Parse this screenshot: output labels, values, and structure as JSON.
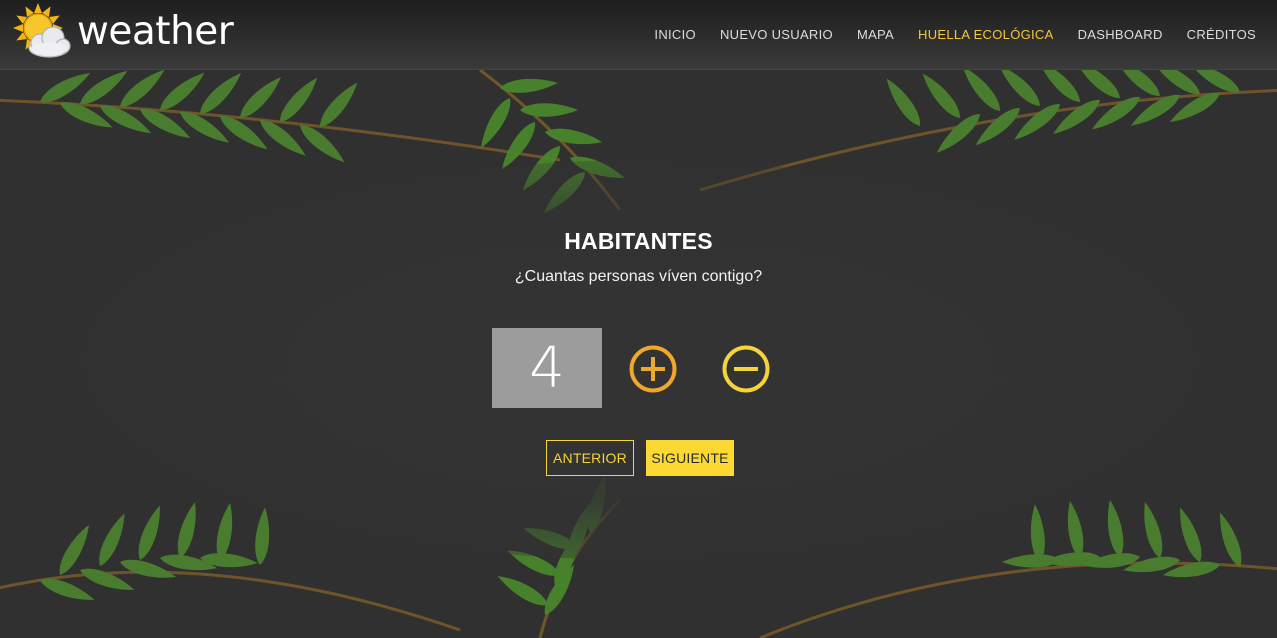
{
  "brand": {
    "name": "weather",
    "logo_icon": "sun-cloud-icon"
  },
  "nav": {
    "items": [
      {
        "label": "INICIO",
        "active": false
      },
      {
        "label": "NUEVO USUARIO",
        "active": false
      },
      {
        "label": "MAPA",
        "active": false
      },
      {
        "label": "HUELLA ECOLÓGICA",
        "active": true
      },
      {
        "label": "DASHBOARD",
        "active": false
      },
      {
        "label": "CRÉDITOS",
        "active": false
      }
    ]
  },
  "form": {
    "title": "HABITANTES",
    "question": "¿Cuantas personas víven contigo?",
    "count": "4",
    "increment_icon": "plus-circle-icon",
    "decrement_icon": "minus-circle-icon",
    "prev_label": "ANTERIOR",
    "next_label": "SIGUIENTE"
  },
  "colors": {
    "navbar": "#2a2a2a",
    "background": "#333333",
    "accent_yellow": "#fcd832",
    "active_nav": "#f2c840",
    "plus_icon": "#f0a828",
    "minus_icon": "#f5d33a",
    "count_box": "#9c9c9c",
    "leaf_green": "#4e8a2e"
  }
}
